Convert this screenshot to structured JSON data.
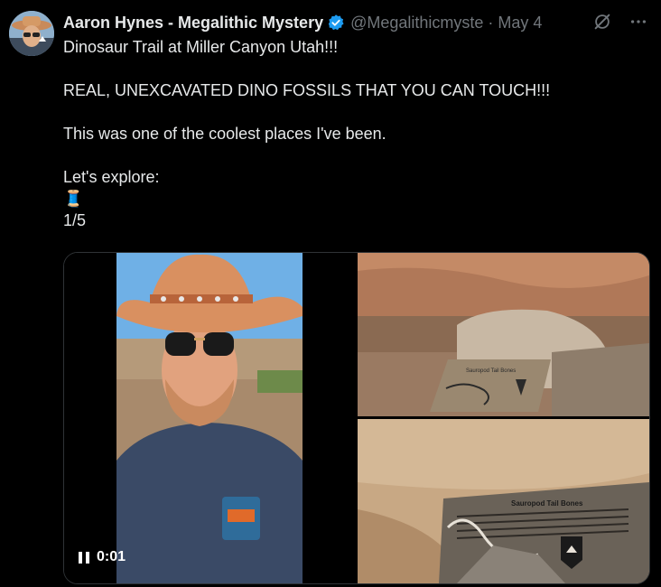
{
  "author": {
    "name": "Aaron Hynes - Megalithic Mystery",
    "handle": "@Megalithicmyste",
    "separator": "·",
    "date": "May 4"
  },
  "tweet": {
    "lines": [
      "Dinosaur Trail at Miller Canyon Utah!!!",
      "",
      "REAL, UNEXCAVATED DINO FOSSILS THAT YOU CAN TOUCH!!!",
      "",
      "This was one of the coolest places I've been.",
      "",
      "Let's explore:",
      "🧵",
      "1/5"
    ]
  },
  "media": {
    "video_time": "0:01",
    "plaque_title": "Sauropod Tail Bones",
    "plaque_title_small": "Sauropod Tail Bones"
  },
  "icons": {
    "verified": "verified-badge-icon",
    "grok": "grok-icon",
    "more": "more-icon",
    "pause": "pause-icon",
    "thread": "thread-spool-icon"
  },
  "colors": {
    "background": "#000000",
    "text": "#e7e9ea",
    "secondary": "#71767b",
    "verified": "#1d9bf0",
    "border": "#2f3336"
  }
}
